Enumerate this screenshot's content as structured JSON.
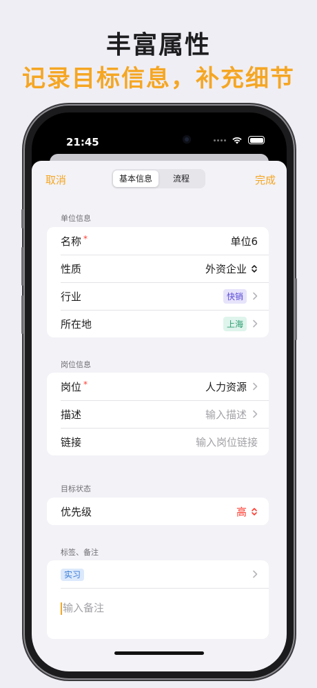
{
  "promo": {
    "title": "丰富属性",
    "subtitle": "记录目标信息，补充细节"
  },
  "status_bar": {
    "time": "21:45"
  },
  "nav": {
    "cancel_label": "取消",
    "done_label": "完成",
    "tabs": [
      {
        "label": "基本信息",
        "active": true
      },
      {
        "label": "流程",
        "active": false
      }
    ]
  },
  "unit_section": {
    "header": "单位信息",
    "rows": {
      "name": {
        "label": "名称",
        "required": "*",
        "value": "单位6"
      },
      "nature": {
        "label": "性质",
        "value": "外资企业"
      },
      "industry": {
        "label": "行业",
        "tag": "快销"
      },
      "location": {
        "label": "所在地",
        "tag": "上海"
      }
    }
  },
  "position_section": {
    "header": "岗位信息",
    "rows": {
      "position": {
        "label": "岗位",
        "required": "*",
        "value": "人力资源"
      },
      "description": {
        "label": "描述",
        "placeholder": "输入描述"
      },
      "link": {
        "label": "链接",
        "placeholder": "输入岗位链接"
      }
    }
  },
  "status_section": {
    "header": "目标状态",
    "rows": {
      "priority": {
        "label": "优先级",
        "value": "高"
      }
    }
  },
  "tags_section": {
    "header": "标签、备注",
    "tag": "实习",
    "notes_placeholder": "输入备注"
  },
  "colors": {
    "accent": "#f5a623",
    "required": "#ff3b30",
    "background": "#efeef5"
  }
}
